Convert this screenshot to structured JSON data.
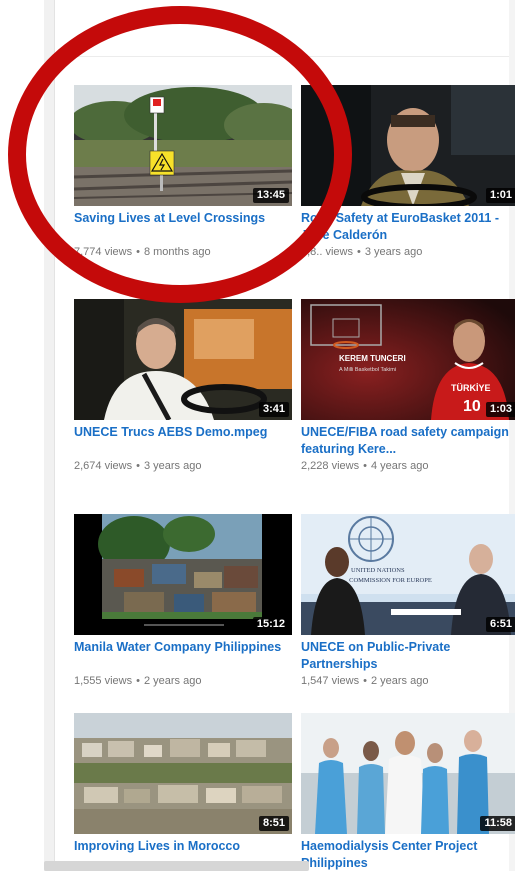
{
  "videos": [
    {
      "title": "Saving Lives at Level Crossings",
      "views": "7,774 views",
      "age": "8 months ago",
      "duration": "13:45",
      "thumb": "rail-crossing"
    },
    {
      "title": "Road Safety at EuroBasket 2011 - José Calderón",
      "views": "5,8.. views",
      "age": "3 years ago",
      "duration": "1:01",
      "thumb": "man-in-car"
    },
    {
      "title": "UNECE Trucs AEBS Demo.mpeg",
      "views": "2,674 views",
      "age": "3 years ago",
      "duration": "3:41",
      "thumb": "truck-driver"
    },
    {
      "title": "UNECE/FIBA road safety campaign featuring Kere...",
      "views": "2,228 views",
      "age": "4 years ago",
      "duration": "1:03",
      "thumb": "basketball-player",
      "overlay_name": "KEREM TUNCERI",
      "overlay_sub": "A Milli Basketbol Takimi",
      "jersey": "TURKIYE 10"
    },
    {
      "title": "Manila Water Company Philippines",
      "views": "1,555 views",
      "age": "2 years ago",
      "duration": "15:12",
      "thumb": "slum-houses"
    },
    {
      "title": "UNECE on Public-Private Partnerships",
      "views": "1,547 views",
      "age": "2 years ago",
      "duration": "6:51",
      "thumb": "interview-studio",
      "banner": "UNITED NATIONS … COMMISSION FOR EUROPE"
    },
    {
      "title": "Improving Lives in Morocco",
      "views": "",
      "age": "",
      "duration": "8:51",
      "thumb": "city-skyline"
    },
    {
      "title": "Haemodialysis Center Project Philippines",
      "views": "",
      "age": "",
      "duration": "11:58",
      "thumb": "hospital-staff"
    }
  ],
  "colors": {
    "link": "#1a6fc6",
    "meta": "#767676",
    "highlight": "#c40a0a"
  }
}
